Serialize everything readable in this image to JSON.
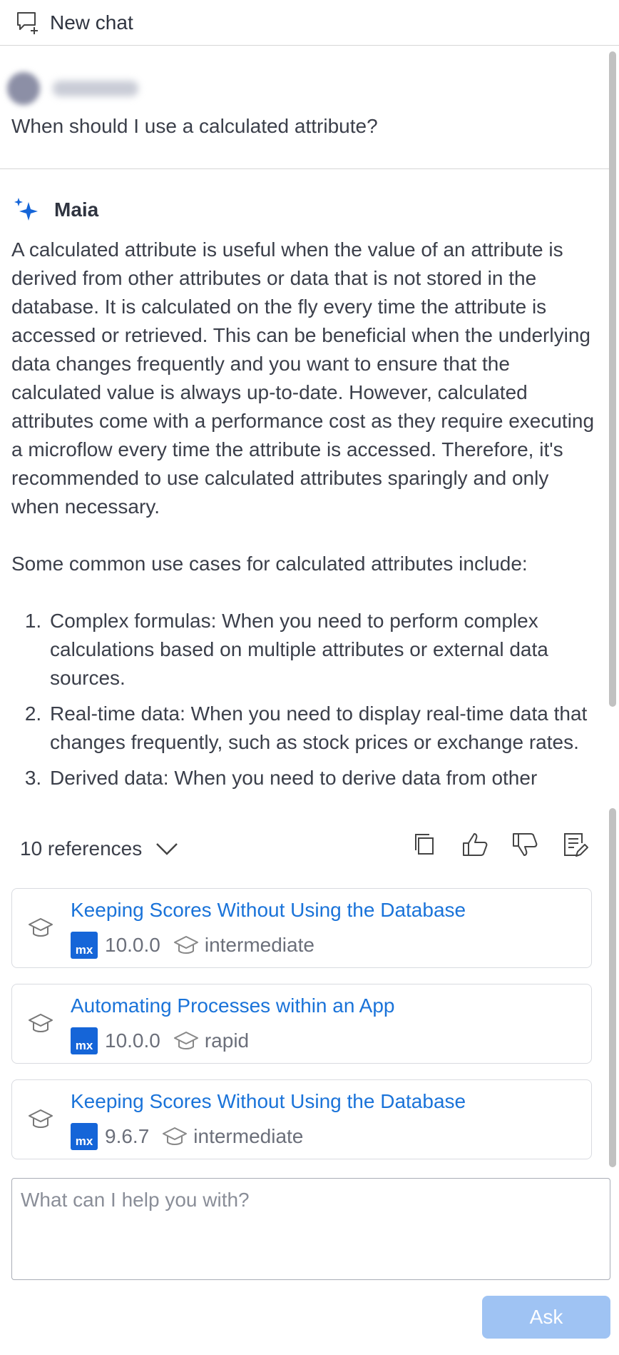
{
  "header": {
    "new_chat_label": "New chat"
  },
  "user_message": {
    "text": "When should I use a calculated attribute?"
  },
  "assistant": {
    "name": "Maia",
    "paragraphs": [
      "A calculated attribute is useful when the value of an attribute is derived from other attributes or data that is not stored in the database. It is calculated on the fly every time the attribute is accessed or retrieved. This can be beneficial when the underlying data changes frequently and you want to ensure that the calculated value is always up-to-date. However, calculated attributes come with a performance cost as they require executing a microflow every time the attribute is accessed. Therefore, it's recommended to use calculated attributes sparingly and only when necessary.",
      "Some common use cases for calculated attributes include:"
    ],
    "list": [
      "Complex formulas: When you need to perform complex calculations based on multiple attributes or external data sources.",
      "Real-time data: When you need to display real-time data that changes frequently, such as stock prices or exchange rates.",
      "Derived data: When you need to derive data from other"
    ]
  },
  "references": {
    "toggle_label": "10 references",
    "actions": [
      "copy-icon",
      "thumbs-up-icon",
      "thumbs-down-icon",
      "edit-note-icon"
    ],
    "items": [
      {
        "title": "Keeping Scores Without Using the Database",
        "badge": "mx",
        "version": "10.0.0",
        "level": "intermediate"
      },
      {
        "title": "Automating Processes within an App",
        "badge": "mx",
        "version": "10.0.0",
        "level": "rapid"
      },
      {
        "title": "Keeping Scores Without Using the Database",
        "badge": "mx",
        "version": "9.6.7",
        "level": "intermediate"
      }
    ]
  },
  "input": {
    "placeholder": "What can I help you with?"
  },
  "ask_button": {
    "label": "Ask"
  },
  "colors": {
    "link": "#1a73d9",
    "accent": "#1565d8",
    "ask_disabled": "#9fc3f3"
  }
}
